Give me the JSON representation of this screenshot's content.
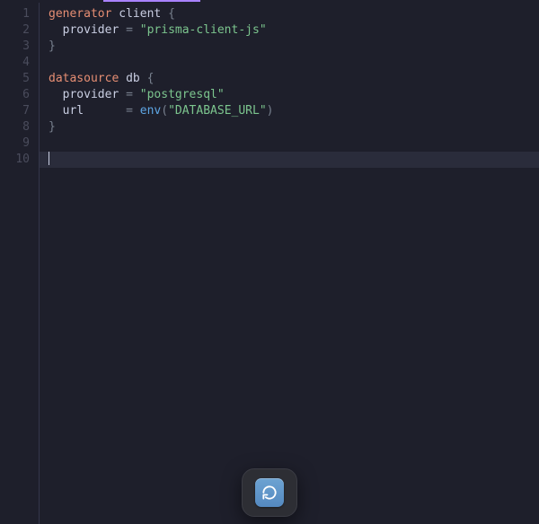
{
  "editor": {
    "lines": [
      {
        "num": "1",
        "tokens": [
          [
            "kw",
            "generator"
          ],
          [
            "sp",
            " "
          ],
          [
            "id",
            "client"
          ],
          [
            "sp",
            " "
          ],
          [
            "pn",
            "{"
          ]
        ]
      },
      {
        "num": "2",
        "tokens": [
          [
            "sp",
            "  "
          ],
          [
            "id",
            "provider"
          ],
          [
            "sp",
            " "
          ],
          [
            "pn",
            "="
          ],
          [
            "sp",
            " "
          ],
          [
            "st",
            "\"prisma-client-js\""
          ]
        ]
      },
      {
        "num": "3",
        "tokens": [
          [
            "pn",
            "}"
          ]
        ]
      },
      {
        "num": "4",
        "tokens": []
      },
      {
        "num": "5",
        "tokens": [
          [
            "kw",
            "datasource"
          ],
          [
            "sp",
            " "
          ],
          [
            "id",
            "db"
          ],
          [
            "sp",
            " "
          ],
          [
            "pn",
            "{"
          ]
        ]
      },
      {
        "num": "6",
        "tokens": [
          [
            "sp",
            "  "
          ],
          [
            "id",
            "provider"
          ],
          [
            "sp",
            " "
          ],
          [
            "pn",
            "="
          ],
          [
            "sp",
            " "
          ],
          [
            "st",
            "\"postgresql\""
          ]
        ]
      },
      {
        "num": "7",
        "tokens": [
          [
            "sp",
            "  "
          ],
          [
            "id",
            "url"
          ],
          [
            "sp",
            "      "
          ],
          [
            "pn",
            "="
          ],
          [
            "sp",
            " "
          ],
          [
            "fn",
            "env"
          ],
          [
            "pn",
            "("
          ],
          [
            "st",
            "\"DATABASE_URL\""
          ],
          [
            "pn",
            ")"
          ]
        ]
      },
      {
        "num": "8",
        "tokens": [
          [
            "pn",
            "}"
          ]
        ]
      },
      {
        "num": "9",
        "tokens": []
      },
      {
        "num": "10",
        "tokens": [],
        "current": true,
        "cursor": true
      }
    ]
  },
  "dock": {
    "icon_name": "prisma-refresh-icon"
  },
  "colors": {
    "background": "#1e1f2b",
    "keyword": "#e68e73",
    "identifier": "#c9cee2",
    "punctuation": "#78808e",
    "string": "#7cc58e",
    "function": "#5ea6e4",
    "tab_accent": "#a982ff"
  }
}
